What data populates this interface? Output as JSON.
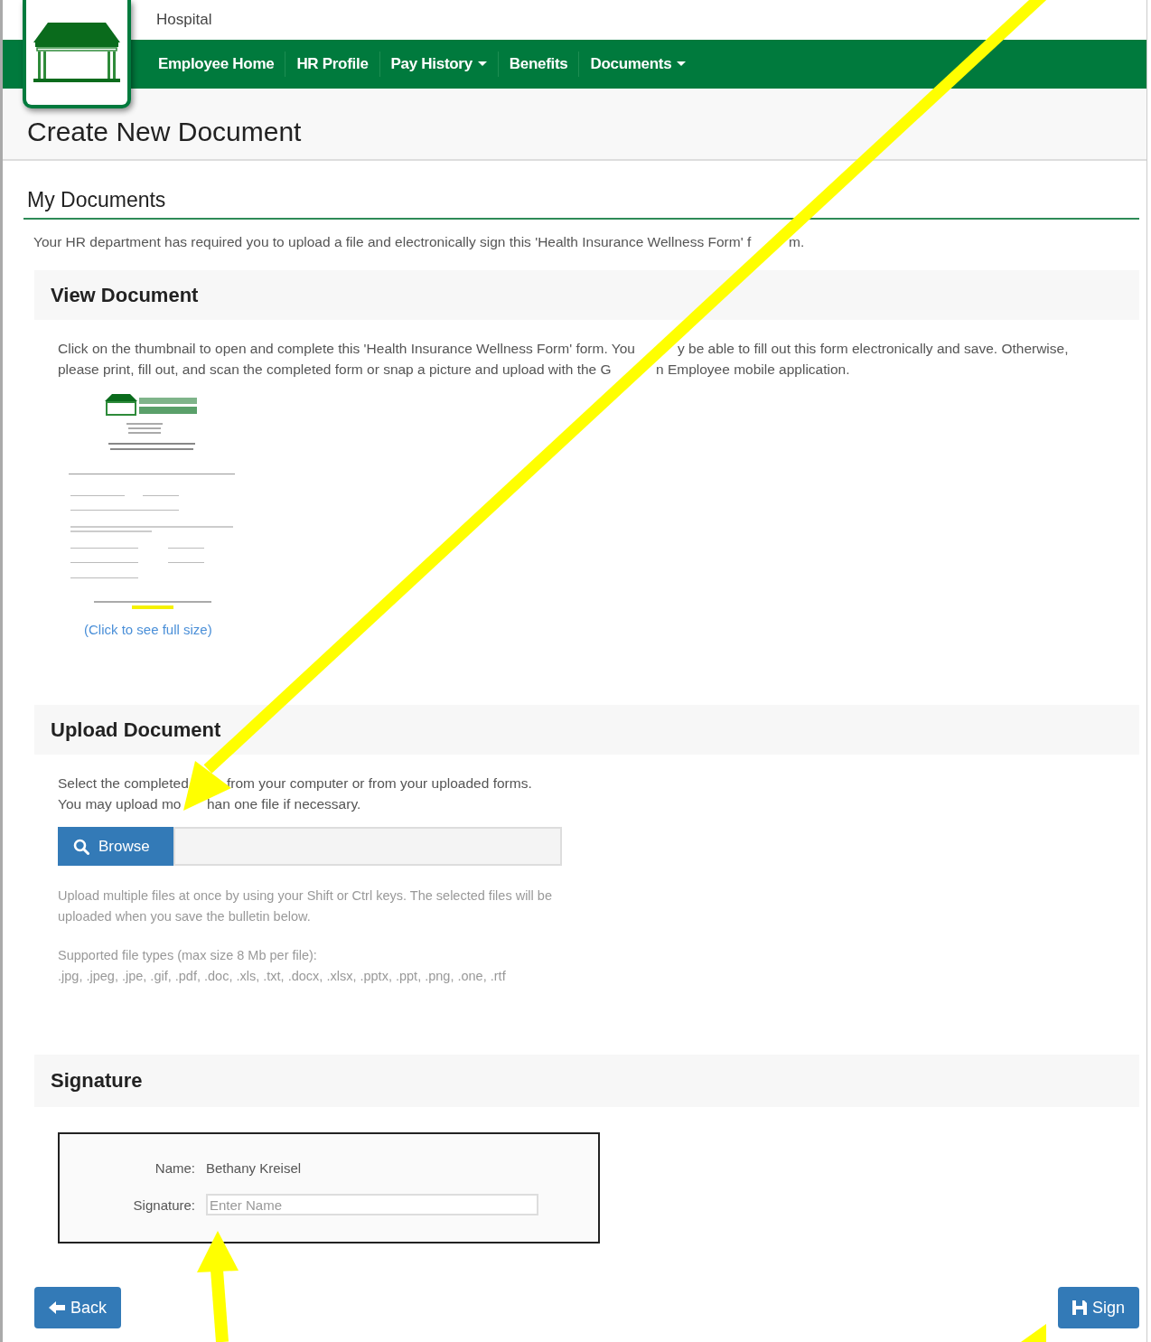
{
  "header": {
    "brand": "Hospital"
  },
  "nav": [
    {
      "label": "Employee Home",
      "has_menu": false
    },
    {
      "label": "HR Profile",
      "has_menu": false
    },
    {
      "label": "Pay History",
      "has_menu": true
    },
    {
      "label": "Benefits",
      "has_menu": false
    },
    {
      "label": "Documents",
      "has_menu": true
    }
  ],
  "page_title": "Create New Document",
  "section_title": "My Documents",
  "intro": [
    "Your HR department has required you to upload a file and electronically sign this 'Health Insurance Wellness Form' f",
    "m."
  ],
  "view_document": {
    "title": "View Document",
    "lines": [
      [
        "Click on the thumbnail to open and complete this 'Health Insurance Wellness Form' form. You",
        "y be able to fill out this form electronically and save. Otherwise,"
      ],
      [
        "please print, fill out, and scan the completed form or snap a picture and upload with the G",
        "n Employee mobile application."
      ]
    ],
    "link": "(Click to see full size)"
  },
  "upload_document": {
    "title": "Upload Document",
    "lines": [
      [
        "Select the completed",
        "from your computer or from your uploaded forms."
      ],
      [
        "You may upload mo",
        "han one file if necessary."
      ]
    ],
    "browse_button": "Browse",
    "help": "Upload multiple files at once by using your Shift or Ctrl keys. The selected files will be uploaded when you save the bulletin below.",
    "types_label": "Supported file types (max size 8 Mb per file):",
    "types": ".jpg, .jpeg, .jpe, .gif, .pdf, .doc, .xls, .txt, .docx, .xlsx, .pptx, .ppt, .png, .one, .rtf"
  },
  "signature": {
    "title": "Signature",
    "name_label": "Name:",
    "name_value": "Bethany Kreisel",
    "signature_label": "Signature:",
    "placeholder": "Enter Name"
  },
  "buttons": {
    "back": "Back",
    "sign": "Sign"
  }
}
